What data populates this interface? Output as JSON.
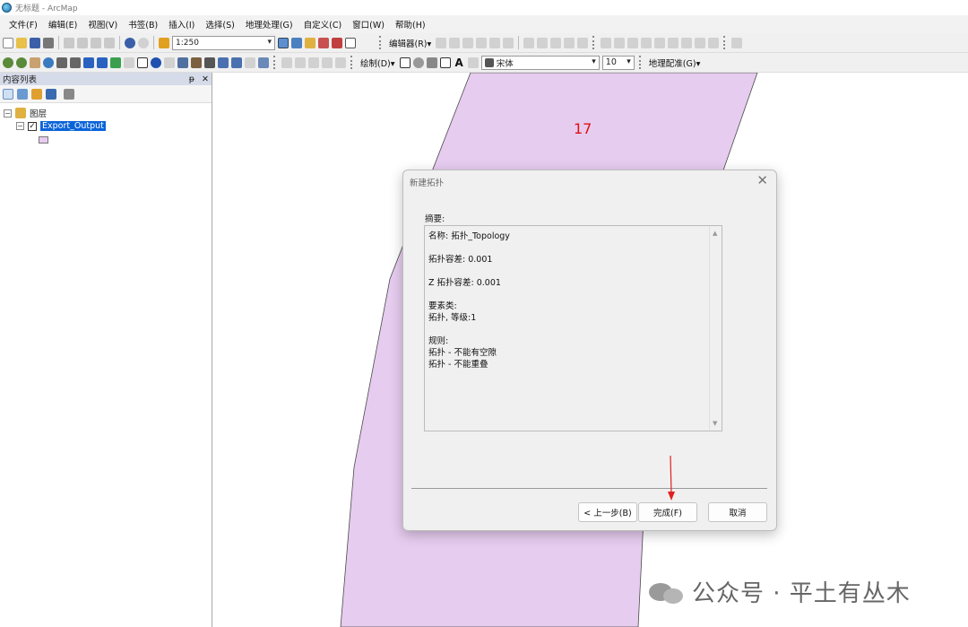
{
  "window": {
    "title": "无标题 - ArcMap"
  },
  "menu": [
    "文件(F)",
    "编辑(E)",
    "视图(V)",
    "书签(B)",
    "插入(I)",
    "选择(S)",
    "地理处理(G)",
    "自定义(C)",
    "窗口(W)",
    "帮助(H)"
  ],
  "toolbar": {
    "scale_value": "1:250",
    "editor_label": "编辑器(R)▾",
    "draw_label": "绘制(D)▾",
    "font_name": "宋体",
    "font_size": "10",
    "georef_label": "地理配准(G)▾",
    "text_tool_label": "A"
  },
  "toc": {
    "title": "内容列表",
    "pin_label": "ᵽ",
    "close_label": "✕",
    "group_name": "图层",
    "layer_name": "Export_Output",
    "layer_checked": true,
    "symbol_color": "#e6ccef"
  },
  "map": {
    "polygon_label": "17",
    "polygon_fill": "#e6ccef",
    "label_color": "#e01010"
  },
  "dialog": {
    "title": "新建拓扑",
    "close_label": "✕",
    "summary_label": "摘要:",
    "summary_lines": [
      "名称: 拓扑_Topology",
      "拓扑容差: 0.001",
      "Z 拓扑容差: 0.001",
      "要素类:",
      "拓扑, 等级:1",
      "规则:",
      "拓扑 - 不能有空隙",
      "拓扑 - 不能重叠"
    ],
    "back_button": "< 上一步(B)",
    "finish_button": "完成(F)",
    "cancel_button": "取消"
  },
  "watermark": {
    "text": "公众号 · 平土有丛木"
  },
  "icons": [
    "app-icon",
    "new-doc-icon",
    "open-folder-icon",
    "save-icon",
    "print-icon",
    "cut-icon",
    "copy-icon",
    "paste-icon",
    "delete-icon",
    "undo-icon",
    "redo-icon",
    "add-data-icon",
    "zoom-in-icon",
    "zoom-out-icon",
    "pan-icon",
    "globe-icon",
    "select-arrow-icon",
    "identify-icon",
    "wechat-icon",
    "red-arrow-annotation"
  ]
}
